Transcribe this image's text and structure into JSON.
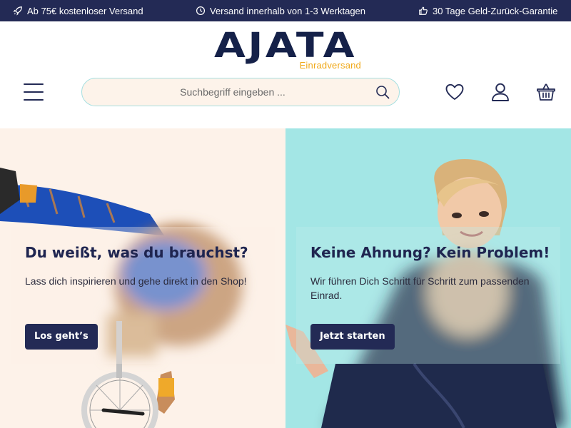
{
  "topbar": {
    "items": [
      {
        "icon": "rocket-icon",
        "label": "Ab 75€ kostenloser Versand"
      },
      {
        "icon": "clock-icon",
        "label": "Versand innerhalb von 1-3 Werktagen"
      },
      {
        "icon": "thumbs-up-icon",
        "label": "30 Tage Geld-Zurück-Garantie"
      }
    ]
  },
  "header": {
    "logo": {
      "wordmark": "AJATA",
      "subtitle": "Einradversand"
    },
    "search": {
      "placeholder": "Suchbegriff eingeben ..."
    },
    "icons": [
      "menu-icon",
      "search-icon",
      "heart-icon",
      "user-icon",
      "basket-icon"
    ]
  },
  "hero": {
    "left": {
      "title": "Du weißt, was du brauchst?",
      "text": "Lass dich inspirieren und gehe direkt in den Shop!",
      "button": "Los geht’s"
    },
    "right": {
      "title": "Keine Ahnung? Kein Problem!",
      "text": "Wir führen Dich Schritt für Schritt zum passenden Einrad.",
      "button": "Jetzt starten"
    }
  },
  "colors": {
    "navy": "#232a55",
    "accent_orange": "#f0a818",
    "panel_left_bg": "#fdf2e9",
    "panel_right_bg": "#a3e6e5"
  }
}
